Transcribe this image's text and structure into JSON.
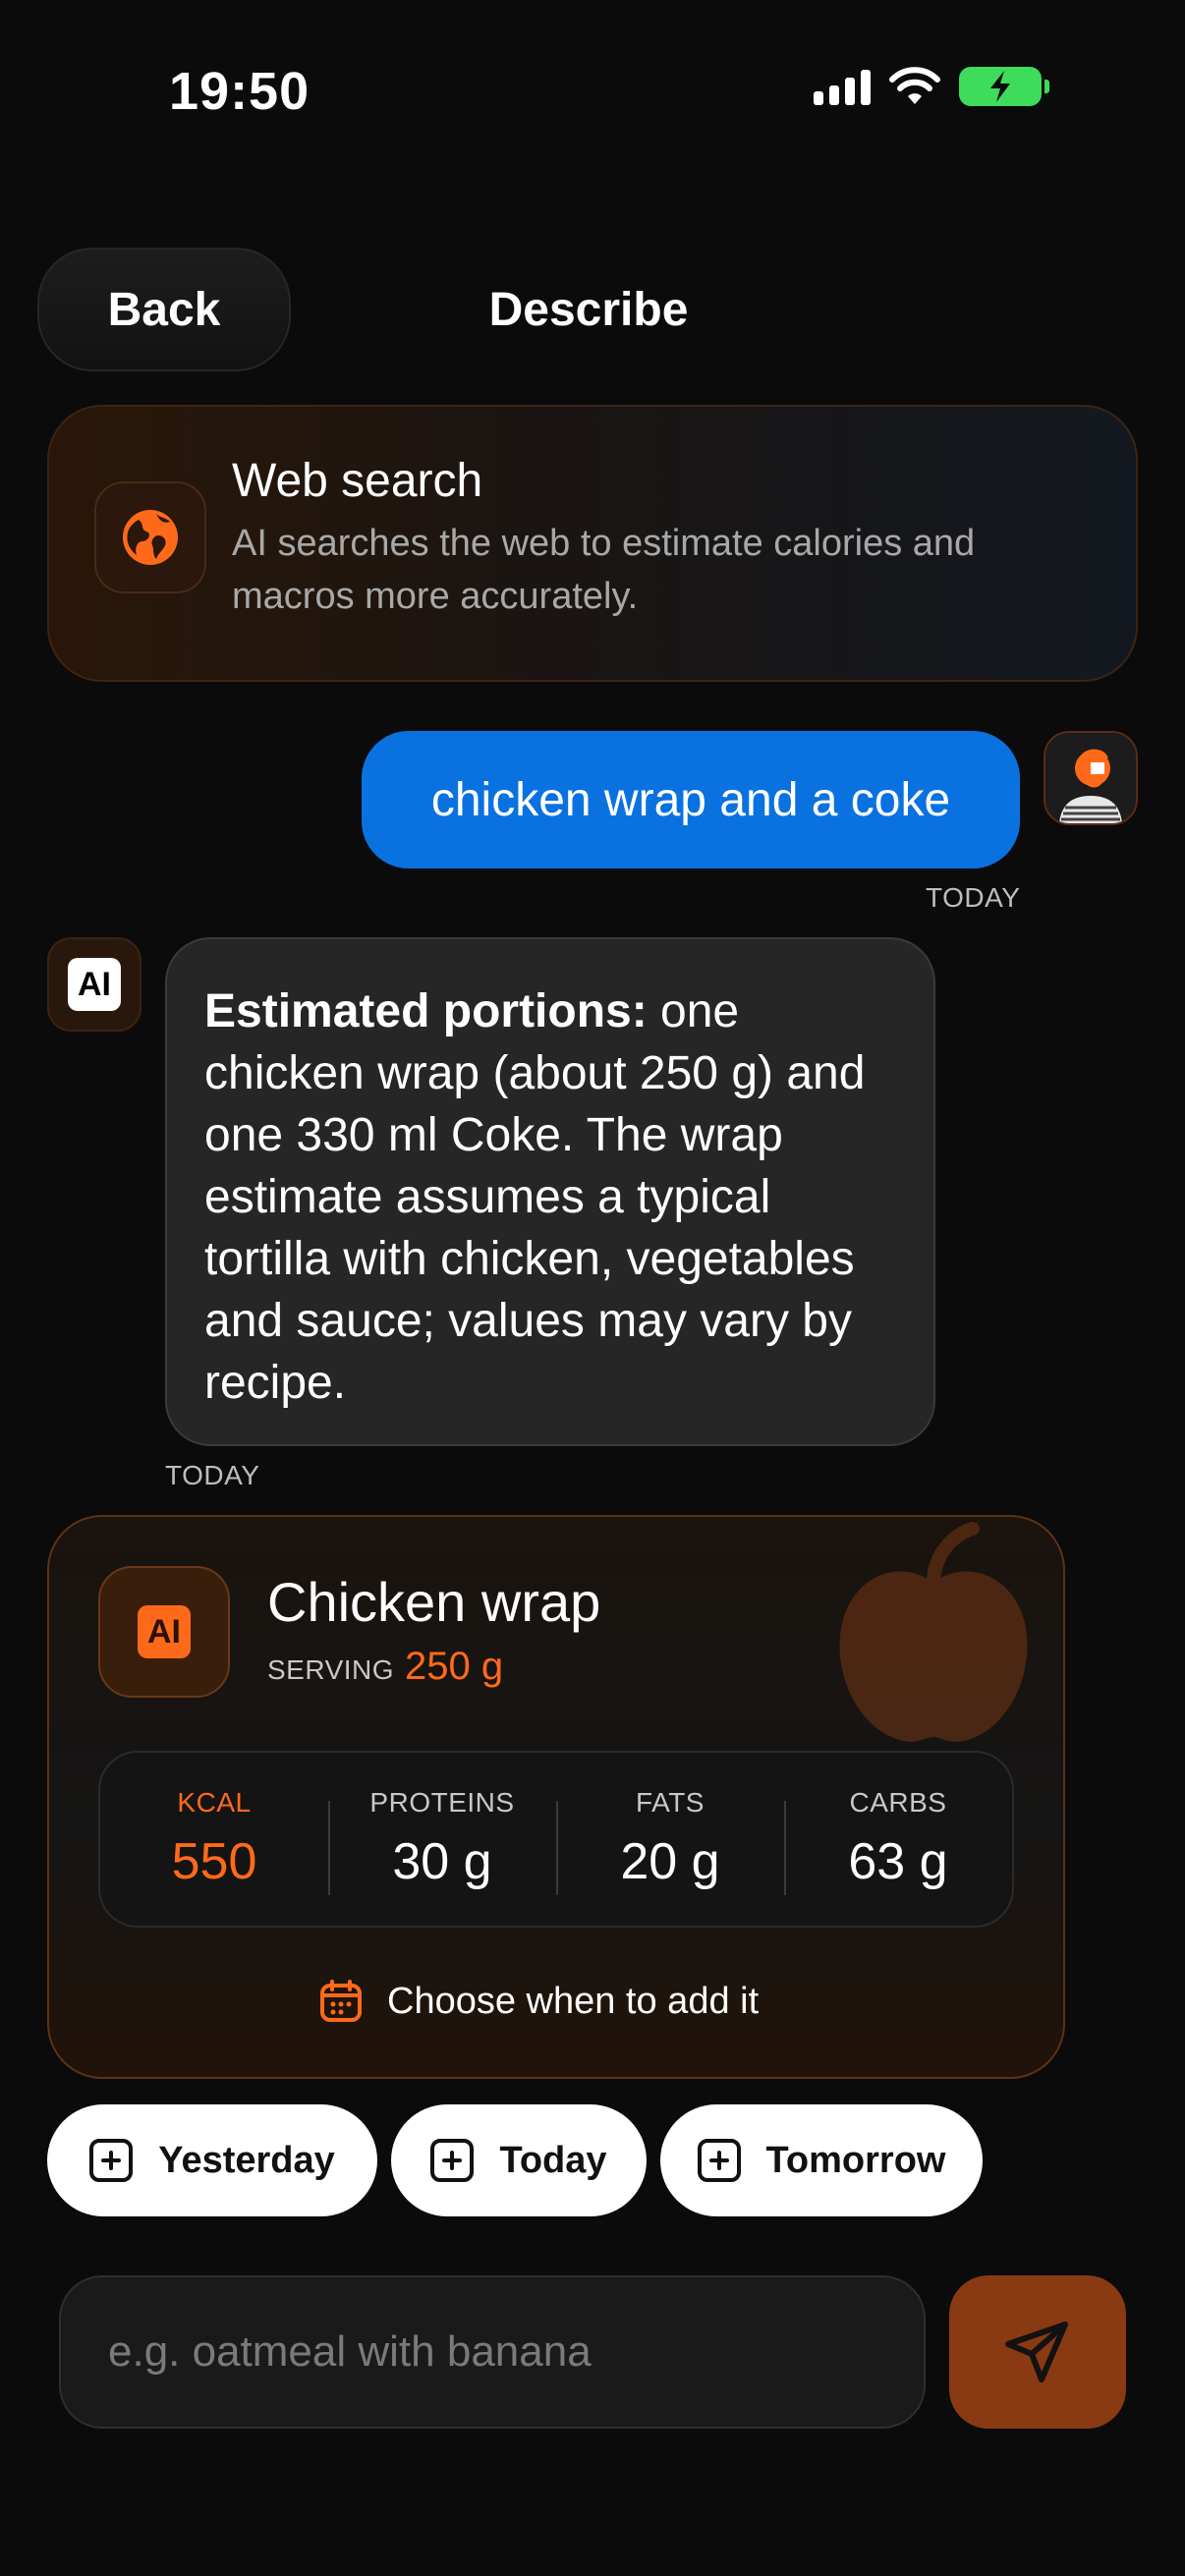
{
  "status_bar": {
    "time": "19:50"
  },
  "header": {
    "back_label": "Back",
    "title": "Describe"
  },
  "web_search": {
    "title": "Web search",
    "description": "AI searches the web to estimate calories and macros more accurately."
  },
  "chat": {
    "user_message": "chicken wrap and a coke",
    "user_timestamp": "TODAY",
    "ai_badge": "AI",
    "ai_message_bold": "Estimated portions:",
    "ai_message_rest": " one chicken wrap (about 250 g) and one 330 ml Coke. The wrap estimate assumes a typical tortilla with chicken, vegetables and sauce; values may vary by recipe.",
    "ai_timestamp": "TODAY"
  },
  "food_card": {
    "badge": "AI",
    "name": "Chicken wrap",
    "serving_label": "SERVING",
    "serving_value": "250 g",
    "macros": [
      {
        "label": "KCAL",
        "value": "550"
      },
      {
        "label": "PROTEINS",
        "value": "30 g"
      },
      {
        "label": "FATS",
        "value": "20 g"
      },
      {
        "label": "CARBS",
        "value": "63 g"
      }
    ],
    "choose_label": "Choose when to add it"
  },
  "day_buttons": [
    "Yesterday",
    "Today",
    "Tomorrow"
  ],
  "composer": {
    "placeholder": "e.g. oatmeal with banana"
  },
  "colors": {
    "accent": "#ff6a1a",
    "user_bubble": "#0a72e0",
    "battery": "#3ddc5b"
  }
}
